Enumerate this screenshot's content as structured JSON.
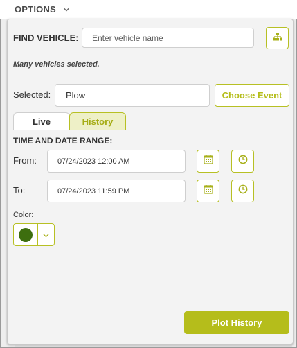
{
  "header": {
    "title": "OPTIONS",
    "toggle_icon": "chevron-down-icon"
  },
  "find_vehicle": {
    "label": "FIND VEHICLE:",
    "placeholder": "Enter vehicle name",
    "tree_icon": "sitemap-icon"
  },
  "selection_note": "Many vehicles selected.",
  "selected": {
    "label": "Selected:",
    "value": "Plow",
    "choose_event_label": "Choose Event"
  },
  "tabs": [
    {
      "label": "Live",
      "active": false
    },
    {
      "label": "History",
      "active": true
    }
  ],
  "time_range": {
    "heading": "TIME AND DATE RANGE:",
    "from_label": "From:",
    "from_value": "07/24/2023 12:00 AM",
    "to_label": "To:",
    "to_value": "07/24/2023 11:59 PM",
    "calendar_icon": "calendar-icon",
    "clock_icon": "clock-icon"
  },
  "color": {
    "label": "Color:",
    "value": "#3d6e0f",
    "dropdown_icon": "chevron-down-icon"
  },
  "actions": {
    "plot_label": "Plot History"
  },
  "theme": {
    "accent": "#b5bd1b",
    "accent_border": "#b7c024",
    "active_tab_bg": "#eef0c7"
  }
}
